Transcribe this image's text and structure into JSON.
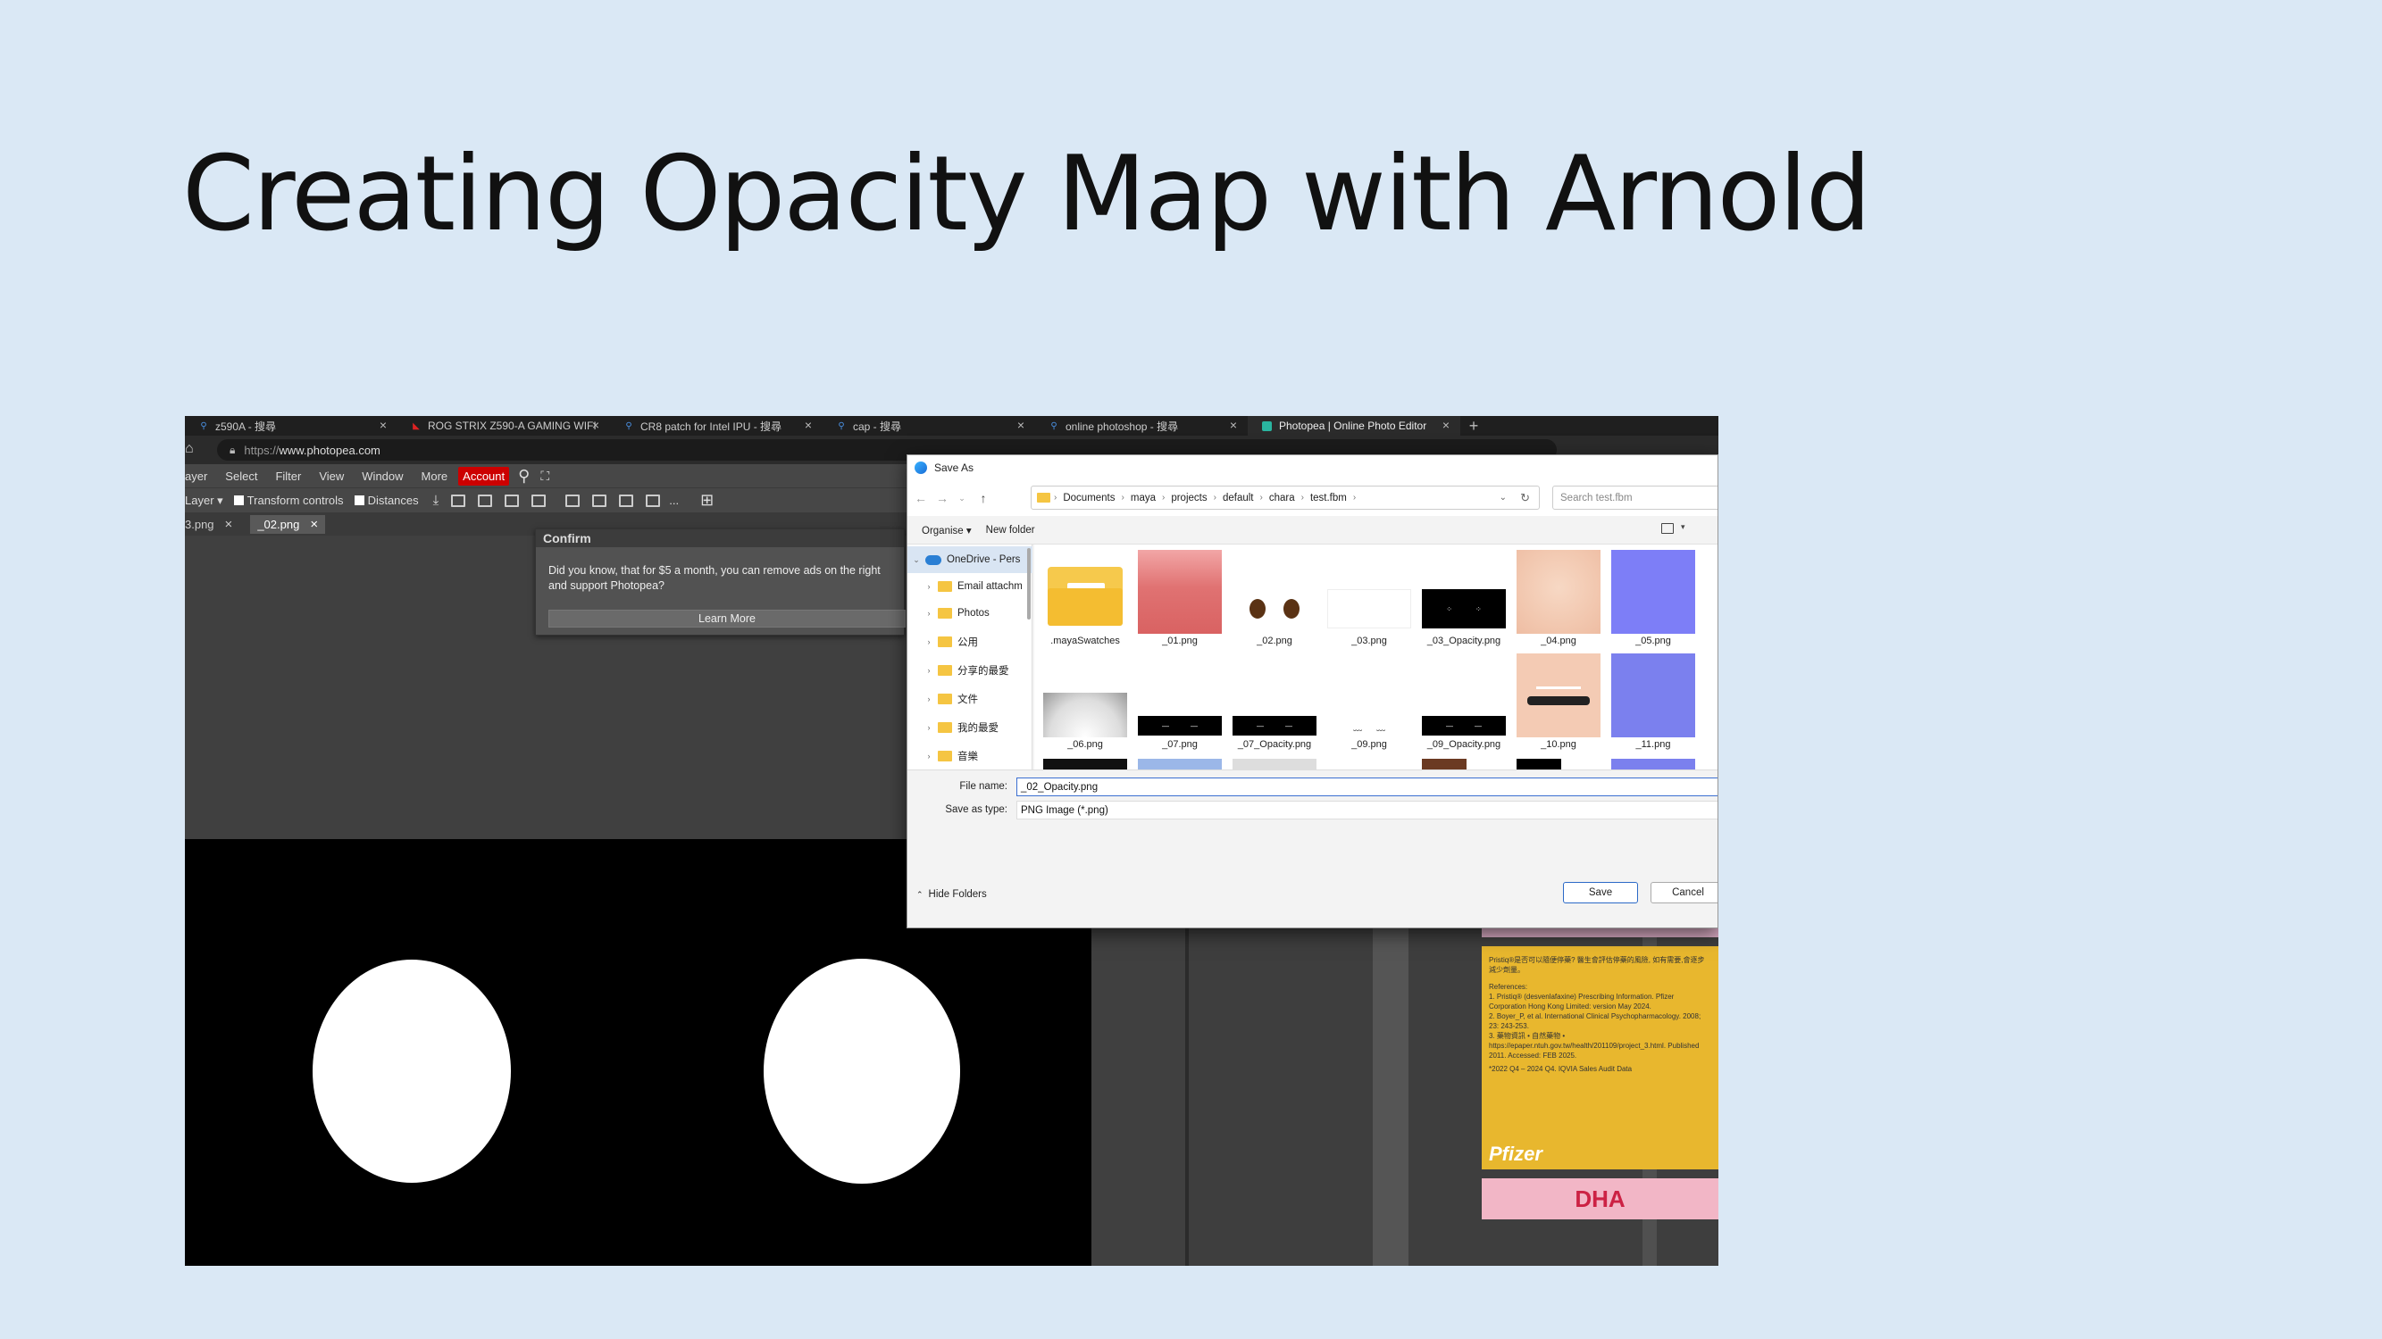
{
  "slide": {
    "title": "Creating Opacity Map with Arnold"
  },
  "browser": {
    "tabs": [
      {
        "label": "z590A - 搜尋",
        "icon": "search-icon"
      },
      {
        "label": "ROG STRIX Z590-A GAMING WIFI",
        "icon": "rog-icon"
      },
      {
        "label": "CR8 patch for Intel IPU - 搜尋",
        "icon": "search-icon"
      },
      {
        "label": "cap - 搜尋",
        "icon": "search-icon"
      },
      {
        "label": "online photoshop - 搜尋",
        "icon": "search-icon"
      },
      {
        "label": "Photopea | Online Photo Editor",
        "icon": "photopea-icon"
      }
    ],
    "new_tab": "+",
    "close": "×",
    "url_prefix": "https://",
    "url_host": "www.photopea.com"
  },
  "photopea": {
    "menu": [
      "ayer",
      "Select",
      "Filter",
      "View",
      "Window",
      "More"
    ],
    "account": "Account",
    "toolbar": {
      "layer_select": "Layer",
      "transform_controls": "Transform controls",
      "distances": "Distances",
      "more": "..."
    },
    "doc_tabs": [
      {
        "label": "3.png"
      },
      {
        "label": "_02.png"
      }
    ],
    "confirm": {
      "title": "Confirm",
      "message": "Did you know, that for $5 a month, you can remove ads on the right and support Photopea?",
      "button": "Learn More"
    },
    "ad": {
      "lines": [
        "Pristiq®是否可以隨便停藥? 醫生會評估停藥的風險, 如有需要,會逐步減少劑量。",
        "References:",
        "1. Pristiq® (desvenlafaxine) Prescribing Information. Pfizer Corporation Hong Kong Limited: version May 2024.",
        "2. Boyer_P, et al. International Clinical Psychopharmacology. 2008; 23: 243-253.",
        "3. 藥物資訊 • 自然藥物 •",
        "https://epaper.ntuh.gov.tw/health/201109/project_3.html. Published 2011. Accessed: FEB 2025.",
        "*2022 Q4 – 2024 Q4. IQVIA Sales Audit Data"
      ],
      "brand": "Pfizer",
      "banner": "DHA"
    }
  },
  "dialog": {
    "title": "Save As",
    "breadcrumb": [
      "Documents",
      "maya",
      "projects",
      "default",
      "chara",
      "test.fbm"
    ],
    "search_placeholder": "Search test.fbm",
    "commands": {
      "organise": "Organise ▾",
      "new_folder": "New folder"
    },
    "tree": [
      {
        "label": "OneDrive - Pers",
        "icon": "cloud-icon",
        "selected": true
      },
      {
        "label": "Email attachm",
        "icon": "folder-icon"
      },
      {
        "label": "Photos",
        "icon": "folder-icon"
      },
      {
        "label": "公用",
        "icon": "folder-icon"
      },
      {
        "label": "分享的最愛",
        "icon": "folder-icon"
      },
      {
        "label": "文件",
        "icon": "folder-icon"
      },
      {
        "label": "我的最愛",
        "icon": "folder-icon"
      },
      {
        "label": "音樂",
        "icon": "folder-icon"
      }
    ],
    "files": [
      {
        "name": ".mayaSwatches",
        "kind": "folder"
      },
      {
        "name": "_01.png",
        "kind": "red"
      },
      {
        "name": "_02.png",
        "kind": "eyes"
      },
      {
        "name": "_03.png",
        "kind": "white"
      },
      {
        "name": "_03_Opacity.png",
        "kind": "dark-dots"
      },
      {
        "name": "_04.png",
        "kind": "skin"
      },
      {
        "name": "_05.png",
        "kind": "normal"
      },
      {
        "name": "_06.png",
        "kind": "glow"
      },
      {
        "name": "_07.png",
        "kind": "black-lashes"
      },
      {
        "name": "_07_Opacity.png",
        "kind": "black-lashes"
      },
      {
        "name": "_09.png",
        "kind": "brows"
      },
      {
        "name": "_09_Opacity.png",
        "kind": "black-lashes"
      },
      {
        "name": "_10.png",
        "kind": "face"
      },
      {
        "name": "_11.png",
        "kind": "normal"
      }
    ],
    "file_name_label": "File name:",
    "file_name_value": "_02_Opacity.png",
    "save_type_label": "Save as type:",
    "save_type_value": "PNG Image (*.png)",
    "hide_folders": "Hide Folders",
    "save": "Save",
    "cancel": "Cancel"
  }
}
